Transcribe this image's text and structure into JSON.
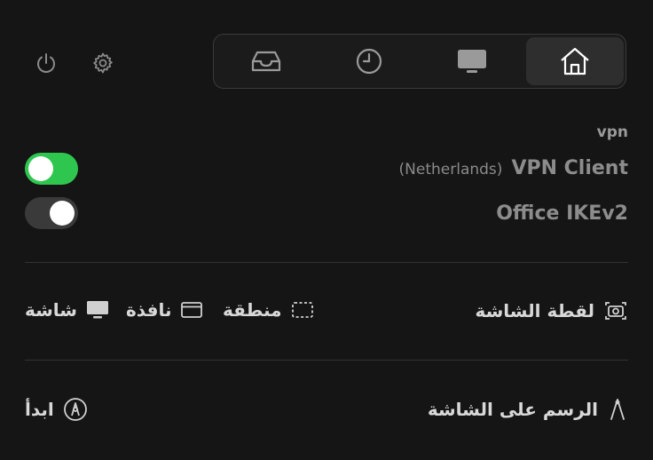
{
  "toolbar": {
    "power_icon": "power-icon",
    "settings_icon": "gear-icon"
  },
  "tabs": [
    {
      "icon": "inbox-tray-icon",
      "active": false
    },
    {
      "icon": "clock-icon",
      "active": false
    },
    {
      "icon": "monitor-icon",
      "active": false
    },
    {
      "icon": "home-icon",
      "active": true
    }
  ],
  "vpn": {
    "section_label": "vpn",
    "items": [
      {
        "name": "VPN Client",
        "detail": "(Netherlands)",
        "enabled": true
      },
      {
        "name": "Office IKEv2",
        "detail": "",
        "enabled": false
      }
    ]
  },
  "screenshot": {
    "title": "لقطة الشاشة",
    "options": [
      {
        "label": "منطقة",
        "icon": "dashed-rect-icon"
      },
      {
        "label": "نافذة",
        "icon": "window-icon"
      },
      {
        "label": "شاشة",
        "icon": "display-icon"
      }
    ]
  },
  "drawing": {
    "title": "الرسم على الشاشة",
    "start_label": "ابدأ"
  },
  "colors": {
    "background": "#151515",
    "toggle_on": "#2fc64f",
    "toggle_off": "#3a3a3a"
  }
}
